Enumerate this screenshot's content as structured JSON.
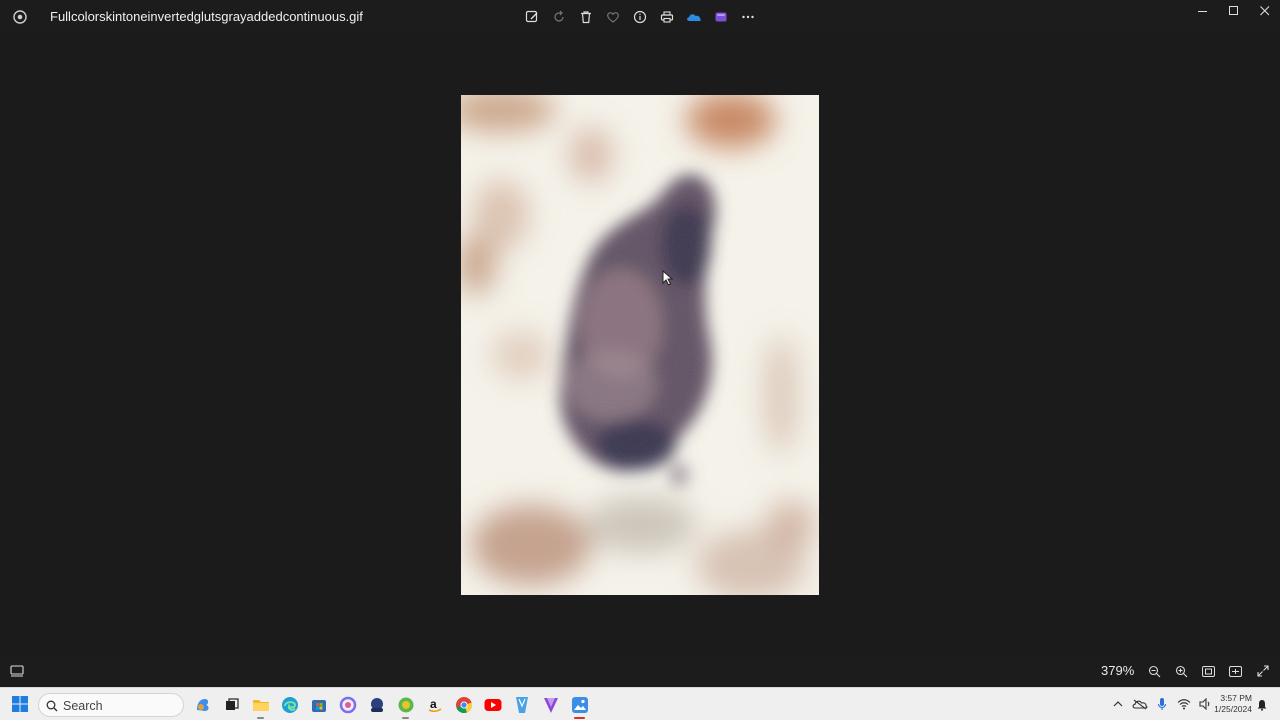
{
  "window": {
    "title": "Fullcolorskintoneinvertedglutsgrayaddedcontinuous.gif",
    "toolbar": [
      "edit-image-icon",
      "rotate-icon",
      "delete-icon",
      "favorite-icon",
      "file-info-icon",
      "print-icon",
      "onedrive-icon",
      "clipchamp-icon",
      "more-icon"
    ],
    "controls": [
      "minimize-icon",
      "maximize-icon",
      "close-icon"
    ]
  },
  "status": {
    "zoom": "379%",
    "controls": [
      "zoom-out-icon",
      "zoom-in-icon",
      "actual-size-icon",
      "fit-to-window-icon",
      "full-screen-icon"
    ]
  },
  "taskbar": {
    "search_label": "Search",
    "apps": [
      "copilot-icon",
      "task-view-icon",
      "file-explorer-icon",
      "edge-icon",
      "store-icon",
      "photos-icon",
      "app-icon",
      "app-icon",
      "amazon-icon",
      "chrome-icon",
      "youtube-icon",
      "app-icon",
      "app-icon",
      "photos-active-icon"
    ],
    "time": "3:57 PM",
    "date": "1/25/2024"
  }
}
